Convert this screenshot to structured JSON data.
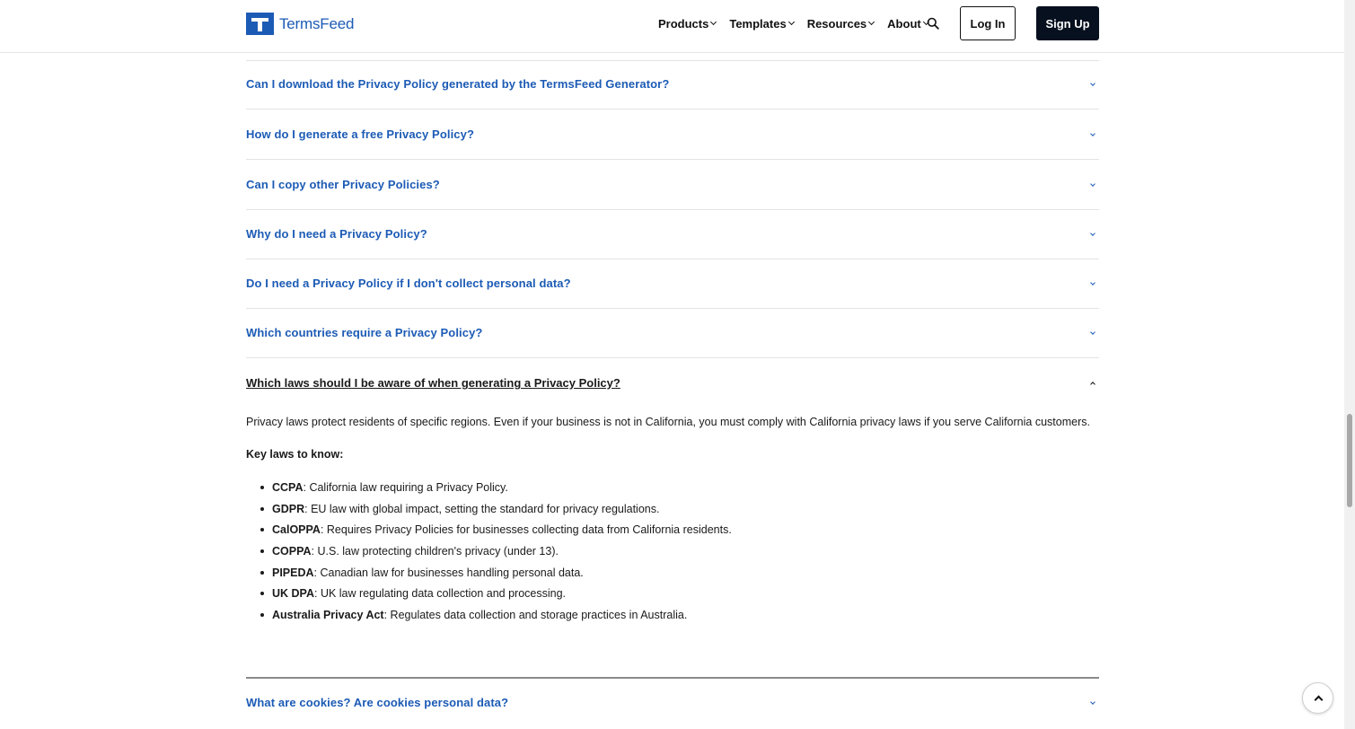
{
  "header": {
    "logo_text": "TermsFeed",
    "nav": [
      {
        "label": "Products"
      },
      {
        "label": "Templates"
      },
      {
        "label": "Resources"
      },
      {
        "label": "About"
      }
    ],
    "login_label": "Log In",
    "signup_label": "Sign Up"
  },
  "faq": {
    "items": [
      {
        "question": "Can I download the Privacy Policy generated by the TermsFeed Generator?"
      },
      {
        "question": "How do I generate a free Privacy Policy?"
      },
      {
        "question": "Can I copy other Privacy Policies?"
      },
      {
        "question": "Why do I need a Privacy Policy?"
      },
      {
        "question": "Do I need a Privacy Policy if I don't collect personal data?"
      },
      {
        "question": "Which countries require a Privacy Policy?"
      }
    ],
    "open": {
      "question": "Which laws should I be aware of when generating a Privacy Policy?",
      "paragraph": "Privacy laws protect residents of specific regions. Even if your business is not in California, you must comply with California privacy laws if you serve California customers.",
      "subheading": "Key laws to know:",
      "laws": [
        {
          "name": "CCPA",
          "desc": ": California law requiring a Privacy Policy."
        },
        {
          "name": "GDPR",
          "desc": ": EU law with global impact, setting the standard for privacy regulations."
        },
        {
          "name": "CalOPPA",
          "desc": ": Requires Privacy Policies for businesses collecting data from California residents."
        },
        {
          "name": "COPPA",
          "desc": ": U.S. law protecting children's privacy (under 13)."
        },
        {
          "name": "PIPEDA",
          "desc": ": Canadian law for businesses handling personal data."
        },
        {
          "name": "UK DPA",
          "desc": ": UK law regulating data collection and processing."
        },
        {
          "name": "Australia Privacy Act",
          "desc": ": Regulates data collection and storage practices in Australia."
        }
      ]
    },
    "last_question": "What are cookies? Are cookies personal data?"
  },
  "colors": {
    "brand_blue": "#1c5bb5",
    "signup_bg": "#07101f"
  }
}
